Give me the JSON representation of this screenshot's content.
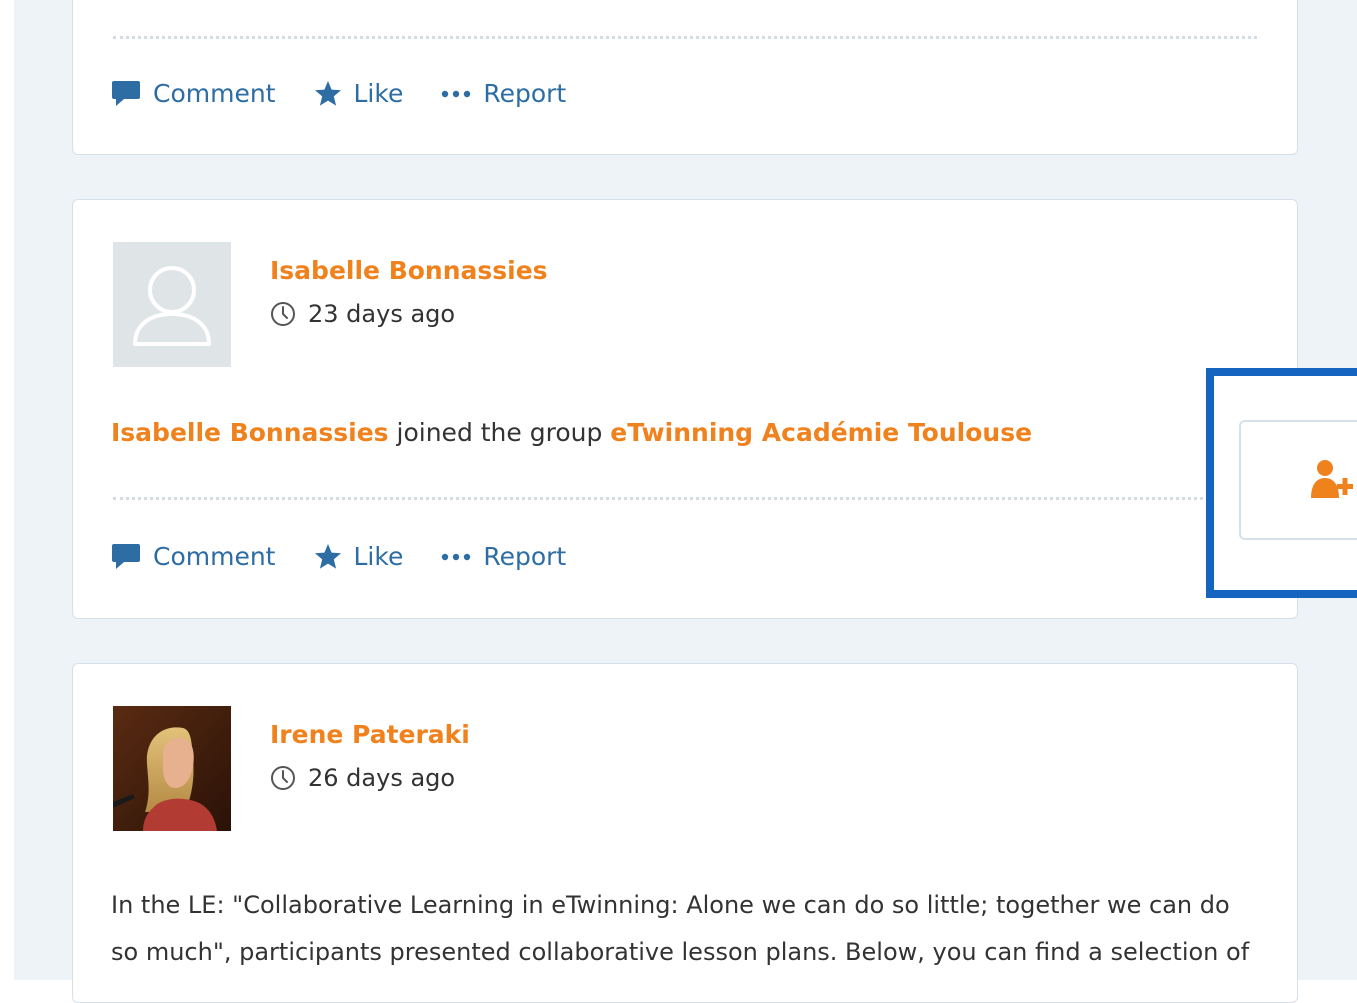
{
  "actions": {
    "comment": "Comment",
    "like": "Like",
    "report": "Report"
  },
  "posts": [
    {
      "author": "Isabelle Bonnassies",
      "time": "23 days ago",
      "activity": {
        "actor": "Isabelle Bonnassies",
        "verb": " joined the group ",
        "target": "eTwinning Académie Toulouse"
      }
    },
    {
      "author": "Irene Pateraki",
      "time": "26 days ago",
      "body": "In the LE: \"Collaborative Learning in eTwinning: Alone we can do so little; together we can do so much\", participants presented collaborative lesson plans. Below, you can find a selection of"
    }
  ],
  "icons": {
    "comment": "speech-bubble-icon",
    "like": "star-icon",
    "report": "ellipsis-icon",
    "time": "clock-icon",
    "avatar_placeholder": "user-silhouette-icon",
    "follow": "add-user-icon"
  },
  "colors": {
    "accent_orange": "#f0821e",
    "action_blue": "#2d6da3",
    "highlight_blue": "#1565c0",
    "feed_background": "#eef3f7"
  }
}
